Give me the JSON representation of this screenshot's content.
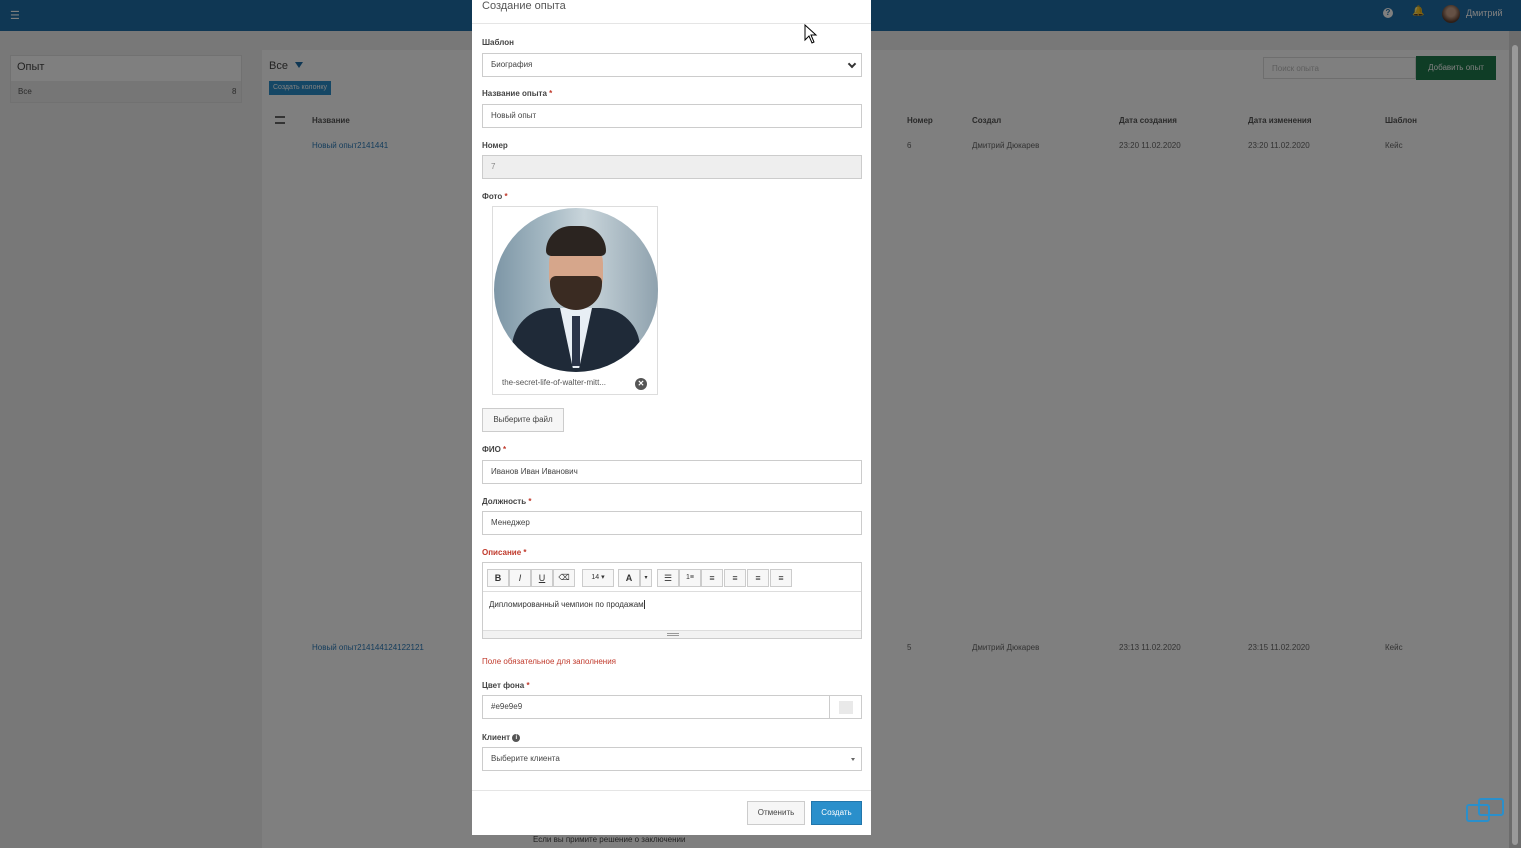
{
  "app": {
    "user_name": "Дмитрий",
    "left_panel": {
      "title": "Опыт",
      "item_label": "Все",
      "item_count": "8"
    },
    "main": {
      "title": "Все",
      "create_column_label": "Создать колонку",
      "search_placeholder": "Поиск опыта",
      "add_button_label": "Добавить опыт",
      "columns": [
        "Название",
        "Номер",
        "Создал",
        "Дата создания",
        "Дата изменения",
        "Шаблон"
      ],
      "rows": [
        {
          "name": "Новый опыт2141441",
          "number": "6",
          "creator": "Дмитрий Дюкарев",
          "created": "23:20 11.02.2020",
          "modified": "23:20 11.02.2020",
          "template": "Кейс"
        },
        {
          "name": "Новый опыт214144124122121",
          "number": "5",
          "creator": "Дмитрий Дюкарев",
          "created": "23:13 11.02.2020",
          "modified": "23:15 11.02.2020",
          "template": "Кейс"
        }
      ],
      "footer_text": "Если вы примите решение о заключении"
    }
  },
  "modal": {
    "title": "Создание опыта",
    "template": {
      "label": "Шаблон",
      "value": "Биография"
    },
    "name": {
      "label": "Название опыта",
      "value": "Новый опыт"
    },
    "number": {
      "label": "Номер",
      "value": "7"
    },
    "photo": {
      "label": "Фото",
      "filename": "the-secret-life-of-walter-mitt...",
      "choose_file_label": "Выберите файл"
    },
    "fio": {
      "label": "ФИО",
      "value": "Иванов Иван Иванович"
    },
    "position": {
      "label": "Должность",
      "value": "Менеджер"
    },
    "description": {
      "label": "Описание",
      "font_size": "14",
      "text": "Дипломированный чемпион по продажам",
      "error": "Поле обязательное для заполнения"
    },
    "bg_color": {
      "label": "Цвет фона",
      "value": "#e9e9e9"
    },
    "client": {
      "label": "Клиент",
      "placeholder": "Выберите клиента"
    },
    "cancel_label": "Отменить",
    "create_label": "Создать"
  },
  "colors": {
    "header": "#1f6fa8",
    "primary": "#2a8fcb",
    "success": "#1f7a4c",
    "error": "#c0392b"
  },
  "required_mark": "*"
}
